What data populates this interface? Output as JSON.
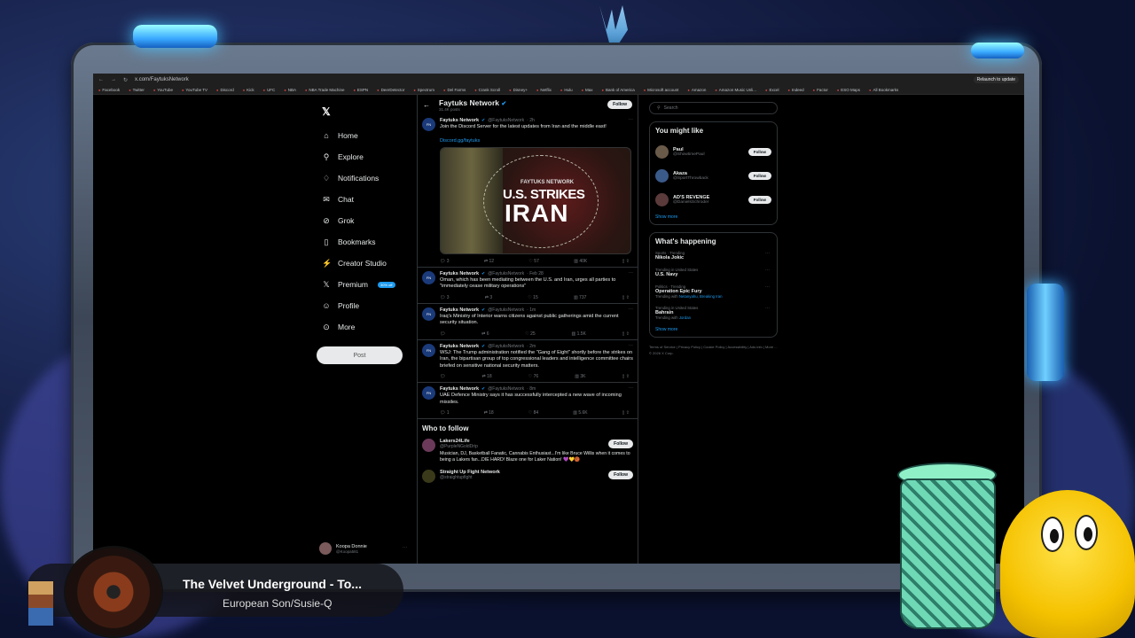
{
  "browser": {
    "url": "x.com/FaytuksNetwork",
    "relaunch_label": "Relaunch to update",
    "bookmarks": [
      "Facebook",
      "Twitter",
      "YouTube",
      "YouTube TV",
      "Discord",
      "Kick",
      "UFC",
      "NBA",
      "NBA Trade Machine",
      "ESPN",
      "DeerDetector",
      "Spectrum",
      "Del Farms",
      "Crank Scroll",
      "Disney+",
      "Netflix",
      "Hulu",
      "Max",
      "Bank of America",
      "Microsoft account",
      "Amazon",
      "Amazon Music Unli...",
      "Excel",
      "Indeed",
      "Factor",
      "ESO Maps",
      "All Bookmarks"
    ]
  },
  "nav": {
    "items": [
      {
        "label": "Home",
        "icon": "home-icon",
        "glyph": "⌂"
      },
      {
        "label": "Explore",
        "icon": "search-icon",
        "glyph": "⚲"
      },
      {
        "label": "Notifications",
        "icon": "bell-icon",
        "glyph": "♢"
      },
      {
        "label": "Chat",
        "icon": "mail-icon",
        "glyph": "✉"
      },
      {
        "label": "Grok",
        "icon": "grok-icon",
        "glyph": "⊘"
      },
      {
        "label": "Bookmarks",
        "icon": "bookmark-icon",
        "glyph": "▯"
      },
      {
        "label": "Creator Studio",
        "icon": "lightning-icon",
        "glyph": "⚡"
      },
      {
        "label": "Premium",
        "icon": "x-icon",
        "glyph": "𝕏",
        "badge": "30% off"
      },
      {
        "label": "Profile",
        "icon": "person-icon",
        "glyph": "☺"
      },
      {
        "label": "More",
        "icon": "more-icon",
        "glyph": "⊙"
      }
    ],
    "post_label": "Post",
    "account_name": "Koopa Donnie",
    "account_handle": "@Koopa581"
  },
  "profile": {
    "name": "Faytuks Network",
    "posts_count": "31.4K posts",
    "follow_label": "Follow"
  },
  "tweets": [
    {
      "author": "Faytuks Network",
      "handle": "@FaytuksNetwork",
      "time": "2h",
      "text": "Join the Discord Server for the latest updates from Iran and the middle east!",
      "link": "Discord.gg/faytuks",
      "has_image": true,
      "image_kicker": "FAYTUKS NETWORK",
      "image_line1": "U.S. STRIKES",
      "image_line2": "IRAN",
      "stats": {
        "replies": "3",
        "reposts": "12",
        "likes": "57",
        "views": "40K"
      }
    },
    {
      "author": "Faytuks Network",
      "handle": "@FaytuksNetwork",
      "time": "Feb 28",
      "text": "Oman, which has been mediating between the U.S. and Iran, urges all parties to \"immediately cease military operations\"",
      "stats": {
        "replies": "3",
        "reposts": "3",
        "likes": "15",
        "views": "737"
      }
    },
    {
      "author": "Faytuks Network",
      "handle": "@FaytuksNetwork",
      "time": "1m",
      "text": "Iraq's Ministry of Interior warns citizens against public gatherings amid the current security situation.",
      "stats": {
        "replies": "",
        "reposts": "6",
        "likes": "25",
        "views": "1.5K"
      }
    },
    {
      "author": "Faytuks Network",
      "handle": "@FaytuksNetwork",
      "time": "2m",
      "text": "WSJ: The Trump administration notified the \"Gang of Eight\" shortly before the strikes on Iran, the bipartisan group of top congressional leaders and intelligence committee chairs briefed on sensitive national security matters.",
      "stats": {
        "replies": "",
        "reposts": "18",
        "likes": "76",
        "views": "3K"
      }
    },
    {
      "author": "Faytuks Network",
      "handle": "@FaytuksNetwork",
      "time": "8m",
      "text": "UAE Defence Ministry says it has successfully intercepted a new wave of incoming missiles.",
      "stats": {
        "replies": "1",
        "reposts": "18",
        "likes": "84",
        "views": "5.6K"
      }
    }
  ],
  "who_to_follow": {
    "title": "Who to follow",
    "accounts": [
      {
        "name": "Lakers24Life",
        "handle": "@PurpleNGoldDrip",
        "bio": "Musician, DJ, Basketball Fanatic, Cannabis Enthusiast...I'm like Bruce Willis when it comes to being a Lakers fan...DIE HARD! Blaze one for Laker Nation! 💜💛🏀",
        "follow_label": "Follow"
      },
      {
        "name": "Straight Up Fight Network",
        "handle": "@straightupfight",
        "bio": "",
        "follow_label": "Follow"
      }
    ]
  },
  "sidebar": {
    "search_placeholder": "Search",
    "you_might_like": {
      "title": "You might like",
      "accounts": [
        {
          "name": "Paul",
          "handle": "@ShowtimePaul",
          "follow_label": "Follow"
        },
        {
          "name": "Akaza",
          "handle": "@SportThrowback",
          "follow_label": "Follow"
        },
        {
          "name": "AD'S REVENGE",
          "handle": "@DanielsSchroder",
          "follow_label": "Follow"
        }
      ],
      "show_more": "Show more"
    },
    "whats_happening": {
      "title": "What's happening",
      "trends": [
        {
          "category": "Sports · Trending",
          "topic": "Nikola Jokic",
          "with": ""
        },
        {
          "category": "Trending in United States",
          "topic": "U.S. Navy",
          "with": ""
        },
        {
          "category": "Politics · Trending",
          "topic": "Operation Epic Fury",
          "with_prefix": "Trending with",
          "with": "Netanyahu, Breaking Iran"
        },
        {
          "category": "Trending in United States",
          "topic": "Bahrain",
          "with_prefix": "Trending with",
          "with": "Jordan"
        }
      ],
      "show_more": "Show more"
    },
    "footer": "Terms of Service | Privacy Policy | Cookie Policy | Accessibility | Ads info | More ... © 2026 X Corp."
  },
  "now_playing": {
    "title": "The Velvet Underground - To...",
    "subtitle": "European Son/Susie-Q"
  }
}
